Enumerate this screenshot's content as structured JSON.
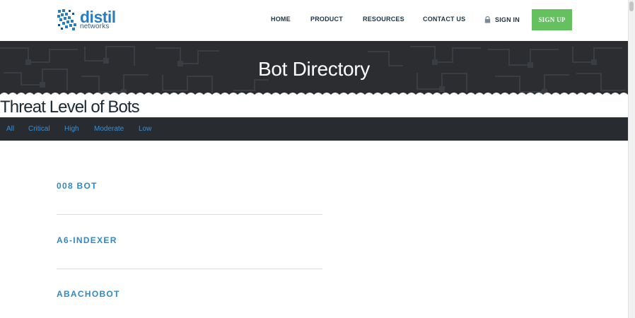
{
  "header": {
    "logo": {
      "word": "distil",
      "sub": "networks"
    },
    "nav": {
      "home": "HOME",
      "product": "PRODUCT",
      "resources": "RESOURCES",
      "contact": "CONTACT US",
      "signin": "SIGN IN"
    },
    "signup_label": "SIGN UP"
  },
  "banner": {
    "title": "Bot Directory"
  },
  "threat": {
    "title": "Threat Level of Bots",
    "filters": [
      "All",
      "Critical",
      "High",
      "Moderate",
      "Low"
    ]
  },
  "bots": [
    "008 BOT",
    "A6-INDEXER",
    "ABACHOBOT"
  ],
  "colors": {
    "brand_blue": "#2a7dbf",
    "signup_green": "#65c160",
    "banner_dark": "#2b2d30",
    "filter_bar": "#282c31",
    "link_blue": "#2f89c8"
  }
}
